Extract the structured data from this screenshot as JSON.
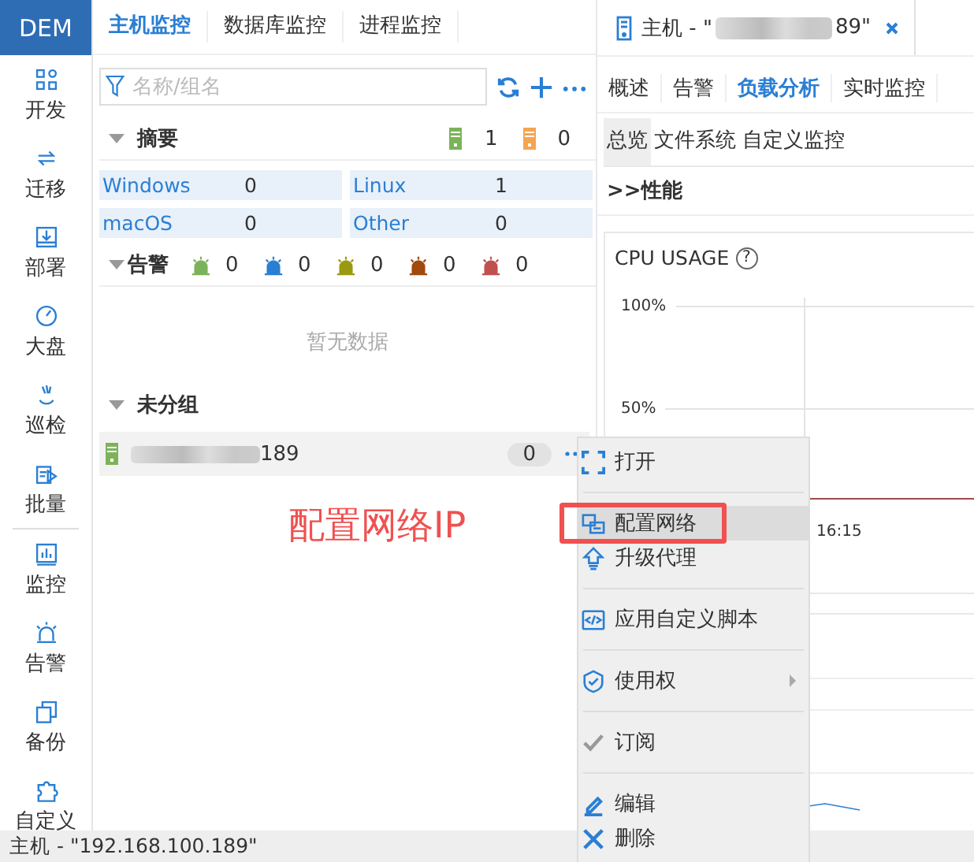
{
  "sidebar": {
    "logo": "DEM",
    "items": [
      {
        "label": "开发"
      },
      {
        "label": "迁移"
      },
      {
        "label": "部署"
      },
      {
        "label": "大盘"
      },
      {
        "label": "巡检"
      },
      {
        "label": "批量"
      },
      {
        "label": "监控"
      },
      {
        "label": "告警"
      },
      {
        "label": "备份"
      },
      {
        "label": "自定义"
      }
    ]
  },
  "main_tabs": [
    {
      "label": "主机监控",
      "selected": true
    },
    {
      "label": "数据库监控",
      "selected": false
    },
    {
      "label": "进程监控",
      "selected": false
    }
  ],
  "search": {
    "placeholder": "名称/组名"
  },
  "summary": {
    "title": "摘要",
    "online_count": "1",
    "offline_count": "0",
    "os_counts": [
      {
        "name": "Windows",
        "count": "0"
      },
      {
        "name": "Linux",
        "count": "1"
      },
      {
        "name": "macOS",
        "count": "0"
      },
      {
        "name": "Other",
        "count": "0"
      }
    ]
  },
  "alarms": {
    "title": "告警",
    "levels": [
      {
        "color": "#7cb35a",
        "count": "0"
      },
      {
        "color": "#2a7fd4",
        "count": "0"
      },
      {
        "color": "#9a9a10",
        "count": "0"
      },
      {
        "color": "#a04a10",
        "count": "0"
      },
      {
        "color": "#c05050",
        "count": "0"
      }
    ],
    "empty_text": "暂无数据"
  },
  "group": {
    "title": "未分组",
    "hosts": [
      {
        "name_suffix": "189",
        "count": "0"
      }
    ]
  },
  "annotation": "配置网络IP",
  "host_tab": {
    "title_prefix": "主机 - \"",
    "title_suffix": "89\""
  },
  "detail_tabs": [
    {
      "label": "概述",
      "selected": false
    },
    {
      "label": "告警",
      "selected": false
    },
    {
      "label": "负载分析",
      "selected": true
    },
    {
      "label": "实时监控",
      "selected": false
    }
  ],
  "sub_tabs": [
    {
      "label": "总览",
      "selected": true
    },
    {
      "label": "文件系统",
      "selected": false
    },
    {
      "label": "自定义监控",
      "selected": false
    }
  ],
  "section_title": ">>性能",
  "cpu_chart": {
    "title": "CPU USAGE",
    "help": "?",
    "y_tick_labels": [
      "100%",
      "50%"
    ],
    "x_tick_label": "16:15"
  },
  "context_menu": {
    "groups": [
      [
        {
          "label": "打开",
          "selected": false,
          "submenu": false
        }
      ],
      [
        {
          "label": "配置网络",
          "selected": true,
          "submenu": false
        },
        {
          "label": "升级代理",
          "selected": false,
          "submenu": false
        }
      ],
      [
        {
          "label": "应用自定义脚本",
          "selected": false,
          "submenu": false
        }
      ],
      [
        {
          "label": "使用权",
          "selected": false,
          "submenu": true
        }
      ],
      [
        {
          "label": "订阅",
          "selected": false,
          "submenu": false
        }
      ],
      [
        {
          "label": "编辑",
          "selected": false,
          "submenu": false
        },
        {
          "label": "删除",
          "selected": false,
          "submenu": false
        }
      ]
    ]
  },
  "status_bar": {
    "text": "主机 - \"192.168.100.189\""
  }
}
